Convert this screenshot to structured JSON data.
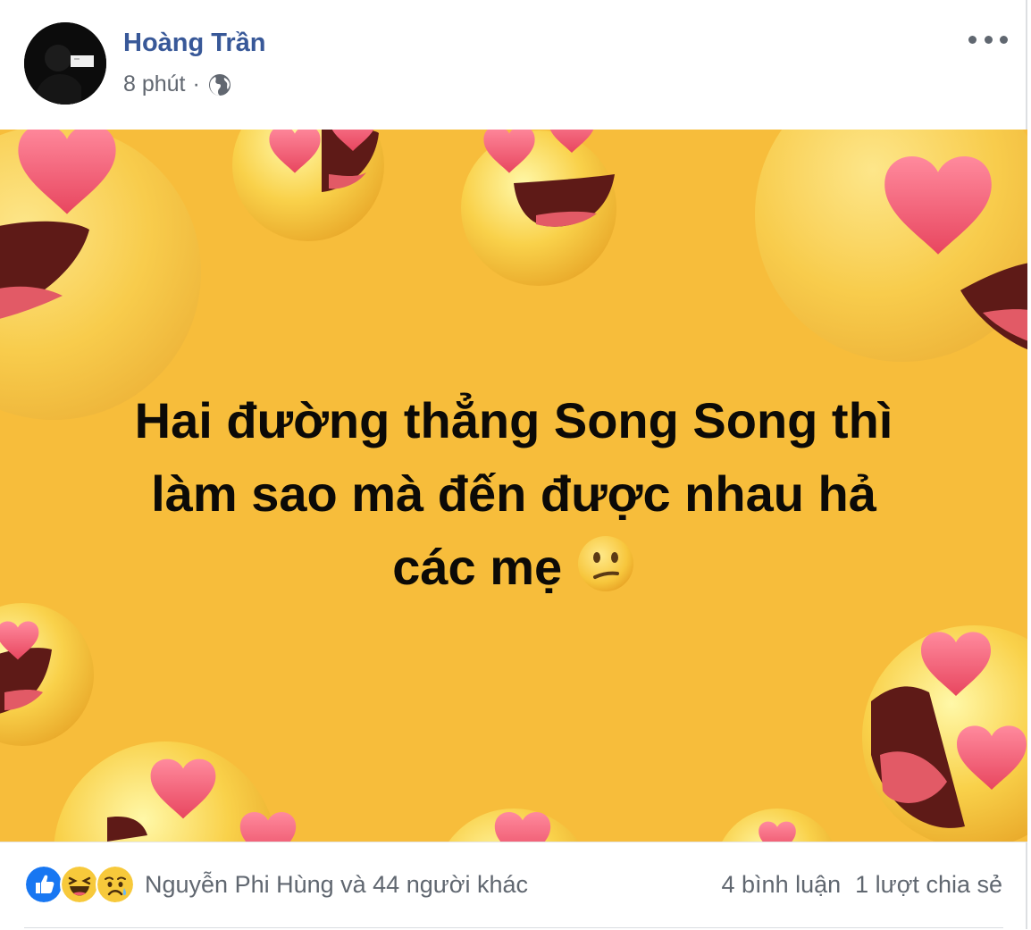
{
  "post": {
    "author": "Hoàng Trần",
    "time": "8 phút",
    "separator": "·",
    "privacy_icon": "globe-icon",
    "more_icon": "more-options-icon",
    "image_text": {
      "line1": "Hai đường thẳng Song Song thì",
      "line2": "làm sao mà đến được nhau hả",
      "line3": "các mẹ"
    },
    "inline_emoji": "confused-face-icon",
    "background_color": "#f7bd3b"
  },
  "footer": {
    "reaction_icons": [
      "like-icon",
      "haha-icon",
      "sad-icon"
    ],
    "reactors": "Nguyễn Phi Hùng và 44 người khác",
    "comments": "4 bình luận",
    "shares": "1 lượt chia sẻ"
  },
  "colors": {
    "author_link": "#385898",
    "meta_text": "#616770",
    "like_blue": "#1877f2"
  }
}
